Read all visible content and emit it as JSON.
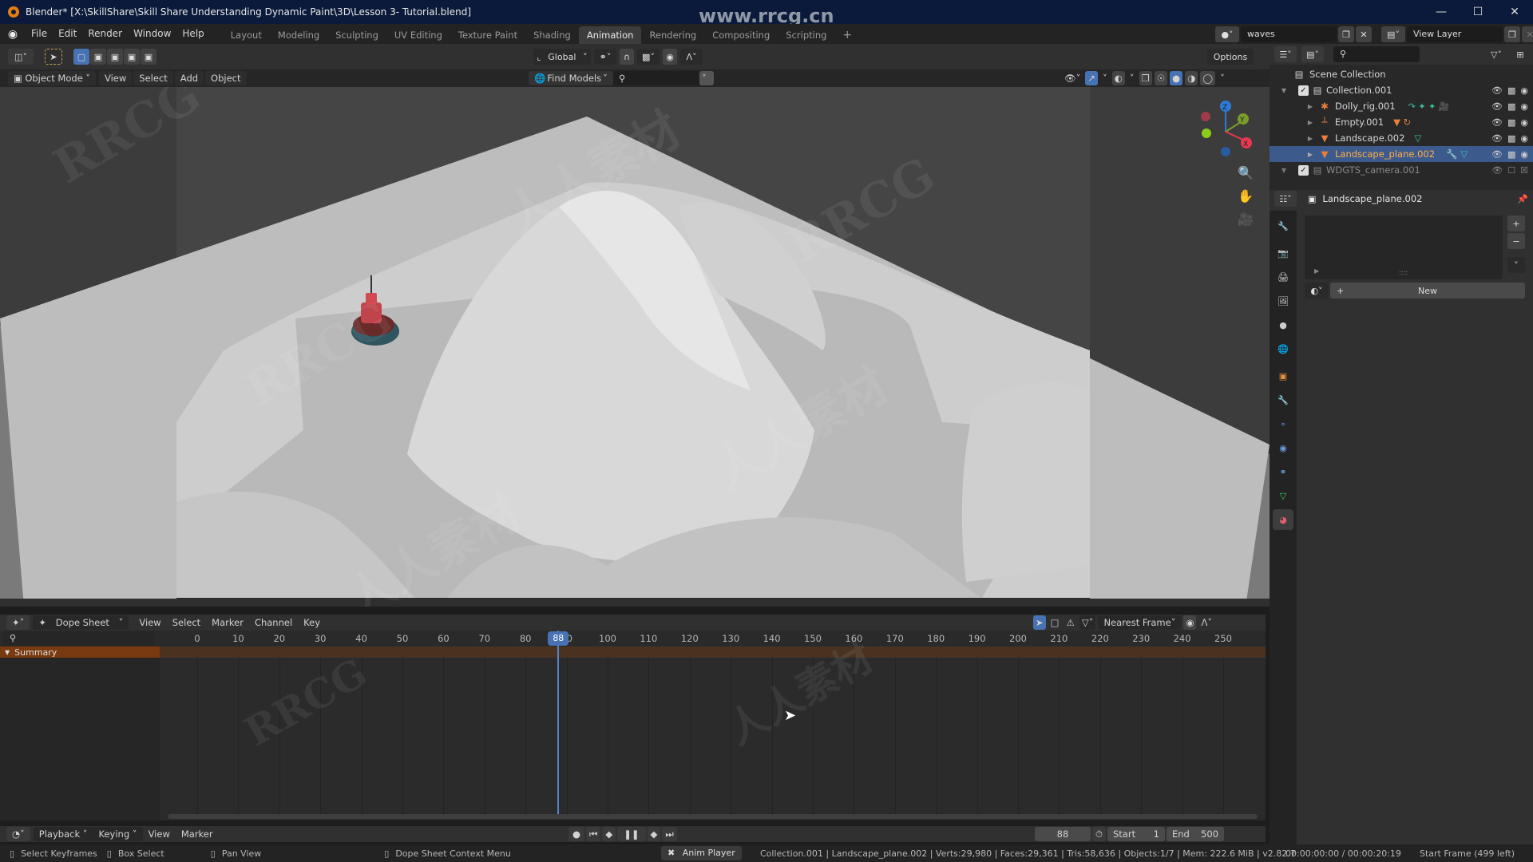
{
  "window": {
    "title": "Blender* [X:\\SkillShare\\Skill Share Understanding Dynamic Paint\\3D\\Lesson 3- Tutorial.blend]",
    "controls": [
      "minimize",
      "maximize",
      "close"
    ]
  },
  "watermark": "www.rrcg.cn",
  "menubar": {
    "items": [
      "File",
      "Edit",
      "Render",
      "Window",
      "Help"
    ],
    "workspaces": [
      "Layout",
      "Modeling",
      "Sculpting",
      "UV Editing",
      "Texture Paint",
      "Shading",
      "Animation",
      "Rendering",
      "Compositing",
      "Scripting"
    ],
    "active_workspace": "Animation",
    "add_workspace": "+",
    "scene": "waves",
    "view_layer": "View Layer"
  },
  "viewport_tools": {
    "transform_orientation": "Global",
    "options_label": "Options"
  },
  "viewport_header": {
    "mode": "Object Mode",
    "menus": [
      "View",
      "Select",
      "Add",
      "Object"
    ],
    "find_models": "Find Models"
  },
  "gizmo": {
    "axes": [
      "Z",
      "Y",
      "X"
    ],
    "colors": {
      "x": "#e8384f",
      "y": "#7a9d2a",
      "z": "#2f7ad8"
    }
  },
  "outliner": {
    "root": "Scene Collection",
    "rows": [
      {
        "name": "Collection.001",
        "type": "collection",
        "depth": 0,
        "selected": false
      },
      {
        "name": "Dolly_rig.001",
        "type": "armature",
        "depth": 1,
        "selected": false
      },
      {
        "name": "Empty.001",
        "type": "empty",
        "depth": 1,
        "selected": false
      },
      {
        "name": "Landscape.002",
        "type": "mesh",
        "depth": 1,
        "selected": false
      },
      {
        "name": "Landscape_plane.002",
        "type": "mesh",
        "depth": 1,
        "selected": true
      },
      {
        "name": "WDGTS_camera.001",
        "type": "collection",
        "depth": 0,
        "selected": false
      }
    ]
  },
  "properties": {
    "object_name": "Landscape_plane.002",
    "new_button": "New",
    "tabs": [
      "tool",
      "render",
      "output",
      "view-layer",
      "scene",
      "world",
      "object",
      "modifiers",
      "particles",
      "physics",
      "constraints",
      "data",
      "material"
    ],
    "active_tab": "material"
  },
  "dopesheet": {
    "mode": "Dope Sheet",
    "menus": [
      "View",
      "Select",
      "Marker",
      "Channel",
      "Key"
    ],
    "snap": "Nearest Frame",
    "channel": "Summary",
    "ticks": [
      0,
      10,
      20,
      30,
      40,
      50,
      60,
      70,
      80,
      90,
      100,
      110,
      120,
      130,
      140,
      150,
      160,
      170,
      180,
      190,
      200,
      210,
      220,
      230,
      240,
      250
    ],
    "current_frame": 88
  },
  "timeline": {
    "menus": [
      "Playback",
      "Keying",
      "View",
      "Marker"
    ],
    "current_frame": "88",
    "start_label": "Start",
    "start": "1",
    "end_label": "End",
    "end": "500"
  },
  "statusbar": {
    "hints": [
      "Select Keyframes",
      "Box Select",
      "Pan View",
      "Dope Sheet Context Menu"
    ],
    "anim_player": "Anim Player",
    "stats": "Collection.001 | Landscape_plane.002 | Verts:29,980 | Faces:29,361 | Tris:58,636 | Objects:1/7 | Mem: 222.6 MiB | v2.82.7",
    "time": "00:00:00:00 / 00:00:20:19",
    "frame_info": "Start Frame (499 left)"
  }
}
